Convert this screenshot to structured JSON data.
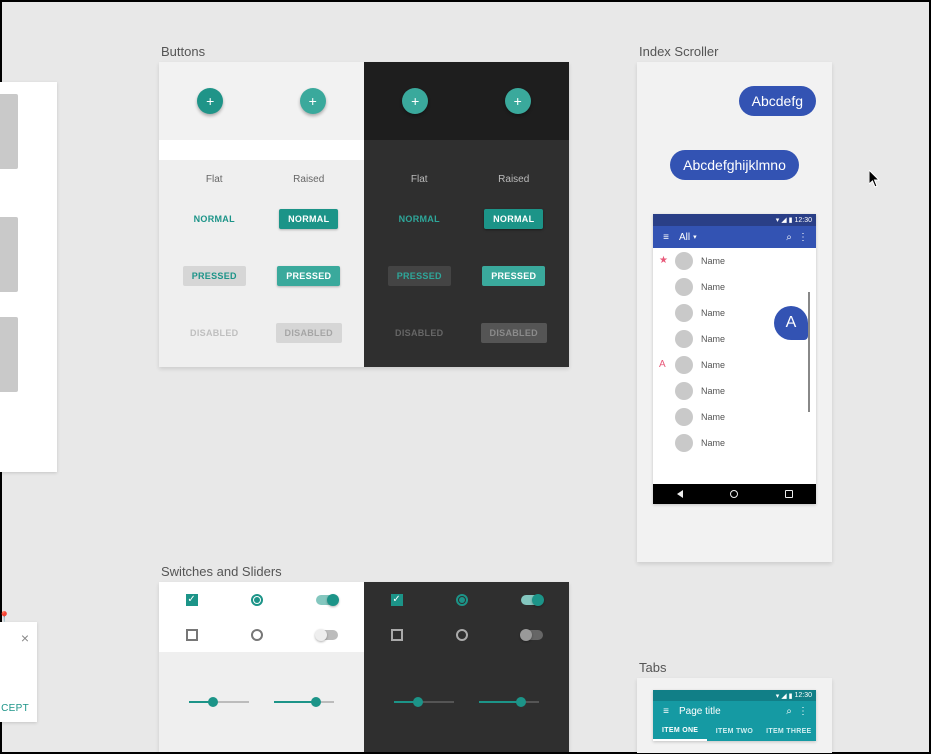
{
  "sections": {
    "buttons": "Buttons",
    "switches": "Switches and Sliders",
    "indexScroller": "Index Scroller",
    "tabs": "Tabs"
  },
  "leftCard": {
    "accept": "CEPT",
    "close": "×"
  },
  "buttons": {
    "flatHeader": "Flat",
    "raisedHeader": "Raised",
    "normal": "NORMAL",
    "pressed": "PRESSED",
    "disabled": "DISABLED",
    "fabGlyph": "+"
  },
  "indexScroller": {
    "chip1": "Abcdefg",
    "chip2": "Abcdefghijklmno",
    "bubbleLetter": "A",
    "statusTime": "12:30",
    "menuGlyph": "≡",
    "dropdownLabel": "All",
    "searchGlyph": "⌕",
    "moreGlyph": "⋮",
    "starGlyph": "★",
    "sectionLetter": "A",
    "contactLabel": "Name",
    "contacts": [
      "Name",
      "Name",
      "Name",
      "Name",
      "Name",
      "Name",
      "Name",
      "Name"
    ]
  },
  "tabs": {
    "statusTime": "12:30",
    "menuGlyph": "≡",
    "pageTitle": "Page title",
    "searchGlyph": "⌕",
    "moreGlyph": "⋮",
    "items": [
      "ITEM ONE",
      "ITEM TWO",
      "ITEM THREE"
    ],
    "activeIndex": 0
  },
  "sliders": {
    "light": [
      40,
      70
    ],
    "dark": [
      40,
      70
    ]
  }
}
